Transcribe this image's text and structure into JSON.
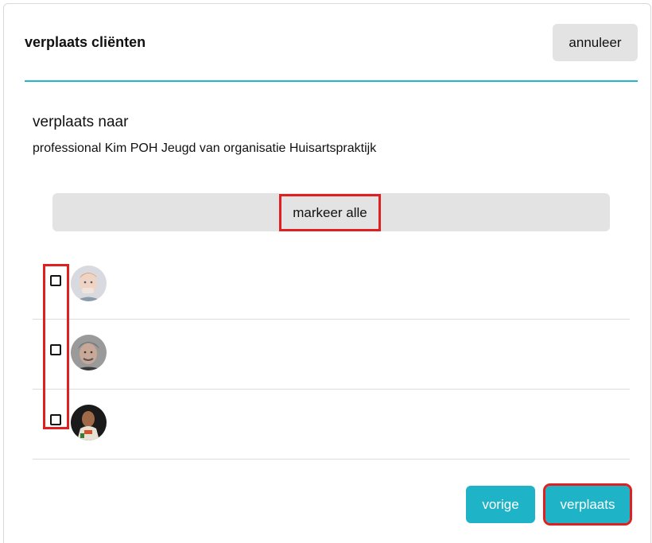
{
  "dialog": {
    "title": "verplaats cliënten",
    "cancel_label": "annuleer"
  },
  "target": {
    "heading": "verplaats naar",
    "description": "professional Kim POH Jeugd van organisatie Huisartspraktijk"
  },
  "mark_all_label": "markeer alle",
  "clients": [
    {
      "checked": false,
      "avatar": "avatar-child-photo"
    },
    {
      "checked": false,
      "avatar": "avatar-grey-haired-man-photo"
    },
    {
      "checked": false,
      "avatar": "avatar-dark-background-photo"
    }
  ],
  "footer": {
    "previous_label": "vorige",
    "move_label": "verplaats"
  },
  "colors": {
    "accent": "#1fb3c8",
    "divider": "#23b5cc",
    "highlight": "#e02020",
    "neutral_button": "#e3e3e3"
  }
}
